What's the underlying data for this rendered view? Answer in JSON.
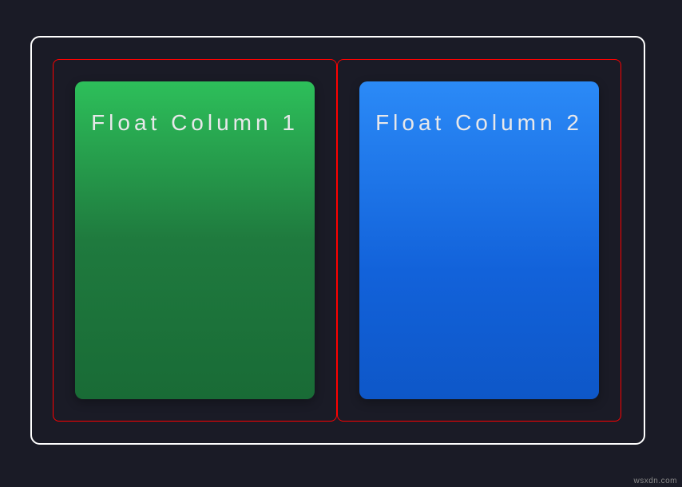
{
  "columns": [
    {
      "label": "Float Column 1",
      "color": "green"
    },
    {
      "label": "Float Column 2",
      "color": "blue"
    }
  ],
  "watermark": "wsxdn.com",
  "style": {
    "background": "#1a1b26",
    "outer_border_color": "#ffffff",
    "inner_border_color": "#ff0000",
    "column_colors": {
      "green_top": "#2dbf5a",
      "green_bottom": "#196b36",
      "blue_top": "#2b8af7",
      "blue_bottom": "#0e57c8"
    }
  }
}
